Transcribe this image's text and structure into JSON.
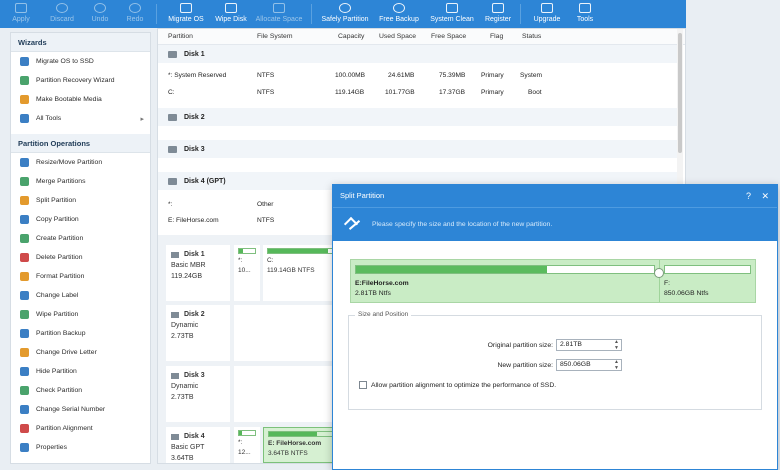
{
  "toolbar": {
    "items": [
      {
        "label": "Apply",
        "enabled": false
      },
      {
        "label": "Discard",
        "enabled": false
      },
      {
        "label": "Undo",
        "enabled": false
      },
      {
        "label": "Redo",
        "enabled": false
      },
      {
        "label": "Migrate OS",
        "enabled": true
      },
      {
        "label": "Wipe Disk",
        "enabled": true
      },
      {
        "label": "Allocate Space",
        "enabled": false
      },
      {
        "label": "Safely Partition",
        "enabled": true
      },
      {
        "label": "Free Backup",
        "enabled": true
      },
      {
        "label": "System Clean",
        "enabled": true
      },
      {
        "label": "Register",
        "enabled": true
      },
      {
        "label": "Upgrade",
        "enabled": true
      },
      {
        "label": "Tools",
        "enabled": true
      }
    ]
  },
  "sidebar": {
    "wizards_title": "Wizards",
    "wizards": [
      {
        "label": "Migrate OS to SSD"
      },
      {
        "label": "Partition Recovery Wizard"
      },
      {
        "label": "Make Bootable Media"
      },
      {
        "label": "All Tools",
        "arrow": "▸"
      }
    ],
    "ops_title": "Partition Operations",
    "ops": [
      {
        "label": "Resize/Move Partition"
      },
      {
        "label": "Merge Partitions"
      },
      {
        "label": "Split Partition"
      },
      {
        "label": "Copy Partition"
      },
      {
        "label": "Create Partition"
      },
      {
        "label": "Delete Partition"
      },
      {
        "label": "Format Partition"
      },
      {
        "label": "Change Label"
      },
      {
        "label": "Wipe Partition"
      },
      {
        "label": "Partition Backup"
      },
      {
        "label": "Change Drive Letter"
      },
      {
        "label": "Hide Partition"
      },
      {
        "label": "Check Partition"
      },
      {
        "label": "Change Serial Number"
      },
      {
        "label": "Partition Alignment"
      },
      {
        "label": "Properties"
      }
    ]
  },
  "table": {
    "columns": [
      "Partition",
      "File System",
      "Capacity",
      "Used Space",
      "Free Space",
      "Flag",
      "Status"
    ],
    "disk1": {
      "name": "Disk 1",
      "rows": [
        [
          "*: System Reserved",
          "NTFS",
          "100.00MB",
          "24.61MB",
          "75.39MB",
          "Primary",
          "System"
        ],
        [
          "C:",
          "NTFS",
          "119.14GB",
          "101.77GB",
          "17.37GB",
          "Primary",
          "Boot"
        ]
      ]
    },
    "disk2": {
      "name": "Disk 2"
    },
    "disk3": {
      "name": "Disk 3"
    },
    "disk4": {
      "name": "Disk 4 (GPT)",
      "rows": [
        [
          "*:",
          "Other"
        ],
        [
          "E: FileHorse.com",
          "NTFS"
        ]
      ]
    }
  },
  "diskmap": {
    "disk1": {
      "title": "Disk 1",
      "type": "Basic MBR",
      "size": "119.24GB"
    },
    "disk1_p1": {
      "label": "*:",
      "size": "10..."
    },
    "disk1_p2": {
      "label": "C:",
      "size": "119.14GB NTFS"
    },
    "disk2": {
      "title": "Disk 2",
      "type": "Dynamic",
      "size": "2.73TB"
    },
    "disk3": {
      "title": "Disk 3",
      "type": "Dynamic",
      "size": "2.73TB"
    },
    "disk4": {
      "title": "Disk 4",
      "type": "Basic GPT",
      "size": "3.64TB"
    },
    "disk4_p1": {
      "label": "*:",
      "size": "12..."
    },
    "disk4_p2": {
      "label": "E: FileHorse.com",
      "size": "3.64TB NTFS"
    }
  },
  "dialog": {
    "title": "Split Partition",
    "help_icon": "?",
    "close_icon": "✕",
    "banner": "Please specify the size and the location of the new partition.",
    "left": {
      "label": "E:FileHorse.com",
      "detail": "2.81TB Ntfs",
      "fill_pct": 64
    },
    "right": {
      "label": "F:",
      "detail": "850.06GB Ntfs",
      "fill_pct": 0
    },
    "section_title": "Size and Position",
    "original_label": "Original partition size:",
    "original_value": "2.81TB",
    "new_label": "New partition size:",
    "new_value": "850.06GB",
    "align_label": "Allow partition alignment to optimize the performance of SSD."
  }
}
